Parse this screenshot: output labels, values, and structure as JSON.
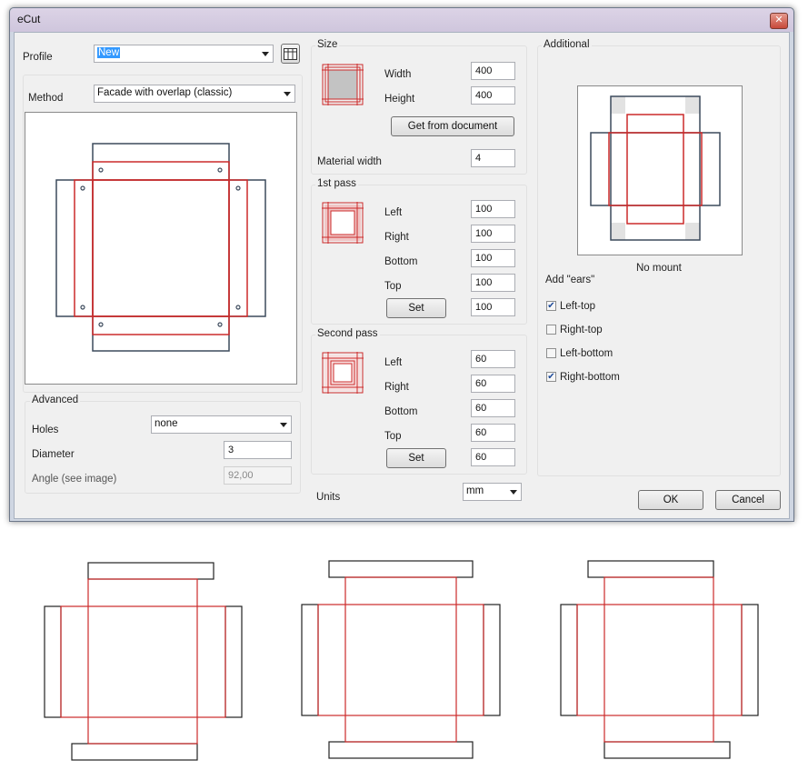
{
  "window": {
    "title": "eCut",
    "close_glyph": "✕"
  },
  "profile": {
    "label": "Profile",
    "value": "New",
    "icon": "table-icon"
  },
  "method": {
    "label": "Method",
    "value": "Facade with overlap (classic)"
  },
  "advanced": {
    "title": "Advanced",
    "holes_label": "Holes",
    "holes_value": "none",
    "diameter_label": "Diameter",
    "diameter_value": "3",
    "angle_label": "Angle (see image)",
    "angle_value": "92,00"
  },
  "size": {
    "title": "Size",
    "width_label": "Width",
    "width_value": "400",
    "height_label": "Height",
    "height_value": "400",
    "get_button": "Get from document",
    "material_label": "Material width",
    "material_value": "4"
  },
  "first_pass": {
    "title": "1st pass",
    "left_label": "Left",
    "left_value": "100",
    "right_label": "Right",
    "right_value": "100",
    "bottom_label": "Bottom",
    "bottom_value": "100",
    "top_label": "Top",
    "top_value": "100",
    "set_button": "Set",
    "extra_value": "100"
  },
  "second_pass": {
    "title": "Second pass",
    "left_label": "Left",
    "left_value": "60",
    "right_label": "Right",
    "right_value": "60",
    "bottom_label": "Bottom",
    "bottom_value": "60",
    "top_label": "Top",
    "top_value": "60",
    "set_button": "Set",
    "extra_value": "60"
  },
  "units": {
    "label": "Units",
    "value": "mm"
  },
  "additional": {
    "title": "Additional",
    "mount_caption": "No mount",
    "ears_label": "Add \"ears\"",
    "ears": [
      {
        "label": "Left-top",
        "checked": true
      },
      {
        "label": "Right-top",
        "checked": false
      },
      {
        "label": "Left-bottom",
        "checked": false
      },
      {
        "label": "Right-bottom",
        "checked": true
      }
    ]
  },
  "buttons": {
    "ok": "OK",
    "cancel": "Cancel"
  },
  "colors": {
    "cut_red": "#cc2a2a",
    "outline_navy": "#3c4a5c",
    "highlight": "#3399ff"
  }
}
